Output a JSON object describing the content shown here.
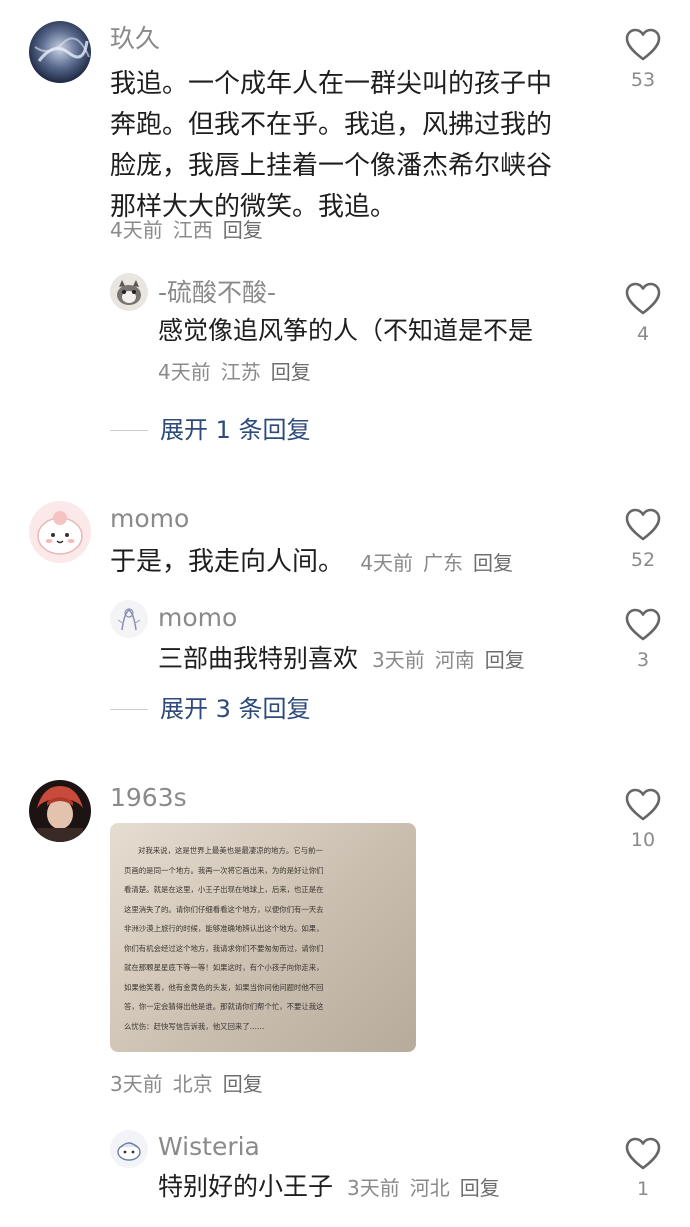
{
  "comments": [
    {
      "username": "玖久",
      "lines": [
        "我追。一个成年人在一群尖叫的孩子中",
        "奔跑。但我不在乎。我追，风拂过我的",
        "脸庞，我唇上挂着一个像潘杰希尔峡谷",
        "那样大大的微笑。我追。"
      ],
      "time": "4天前",
      "location": "江西",
      "reply_label": "回复",
      "likes": "53",
      "replies": [
        {
          "username": "-硫酸不酸-",
          "text": "感觉像追风筝的人（不知道是不是",
          "time": "4天前",
          "location": "江苏",
          "reply_label": "回复",
          "likes": "4"
        }
      ],
      "expand_label": "展开 1 条回复"
    },
    {
      "username": "momo",
      "text": "于是，我走向人间。",
      "time": "4天前",
      "location": "广东",
      "reply_label": "回复",
      "likes": "52",
      "replies": [
        {
          "username": "momo",
          "text": "三部曲我特别喜欢",
          "time": "3天前",
          "location": "河南",
          "reply_label": "回复",
          "likes": "3"
        }
      ],
      "expand_label": "展开 3 条回复"
    },
    {
      "username": "1963s",
      "image_text": [
        "对我来说，这是世界上最美也是最凄凉的地方。它与前一",
        "页画的是同一个地方。我再一次将它画出来，为的是好让你们",
        "看清楚。就是在这里，小王子出现在地球上，后来，也正是在",
        "这里消失了的。请你们仔细看看这个地方，以便你们有一天去",
        "非洲沙漠上旅行的时候，能够准确地辨认出这个地方。如果，",
        "你们有机会经过这个地方，我请求你们不要匆匆而过，请你们",
        "就在那颗星星底下等一等！如果这时，有个小孩子向你走来，",
        "如果他笑着，他有金黄色的头发，如果当你问他问题时他不回",
        "答，你一定会猜得出他是谁。那就请你们帮个忙，不要让我这",
        "么忧伤：赶快写信告诉我，他又回来了……"
      ],
      "time": "3天前",
      "location": "北京",
      "reply_label": "回复",
      "likes": "10",
      "replies": [
        {
          "username": "Wisteria",
          "text": "特别好的小王子",
          "time": "3天前",
          "location": "河北",
          "reply_label": "回复",
          "likes": "1"
        }
      ]
    }
  ],
  "icons": {
    "like": "heart-outline-icon"
  },
  "colors": {
    "meta": "#8a8a8a",
    "link": "#2d4a7a",
    "text": "#1e1e1e"
  }
}
